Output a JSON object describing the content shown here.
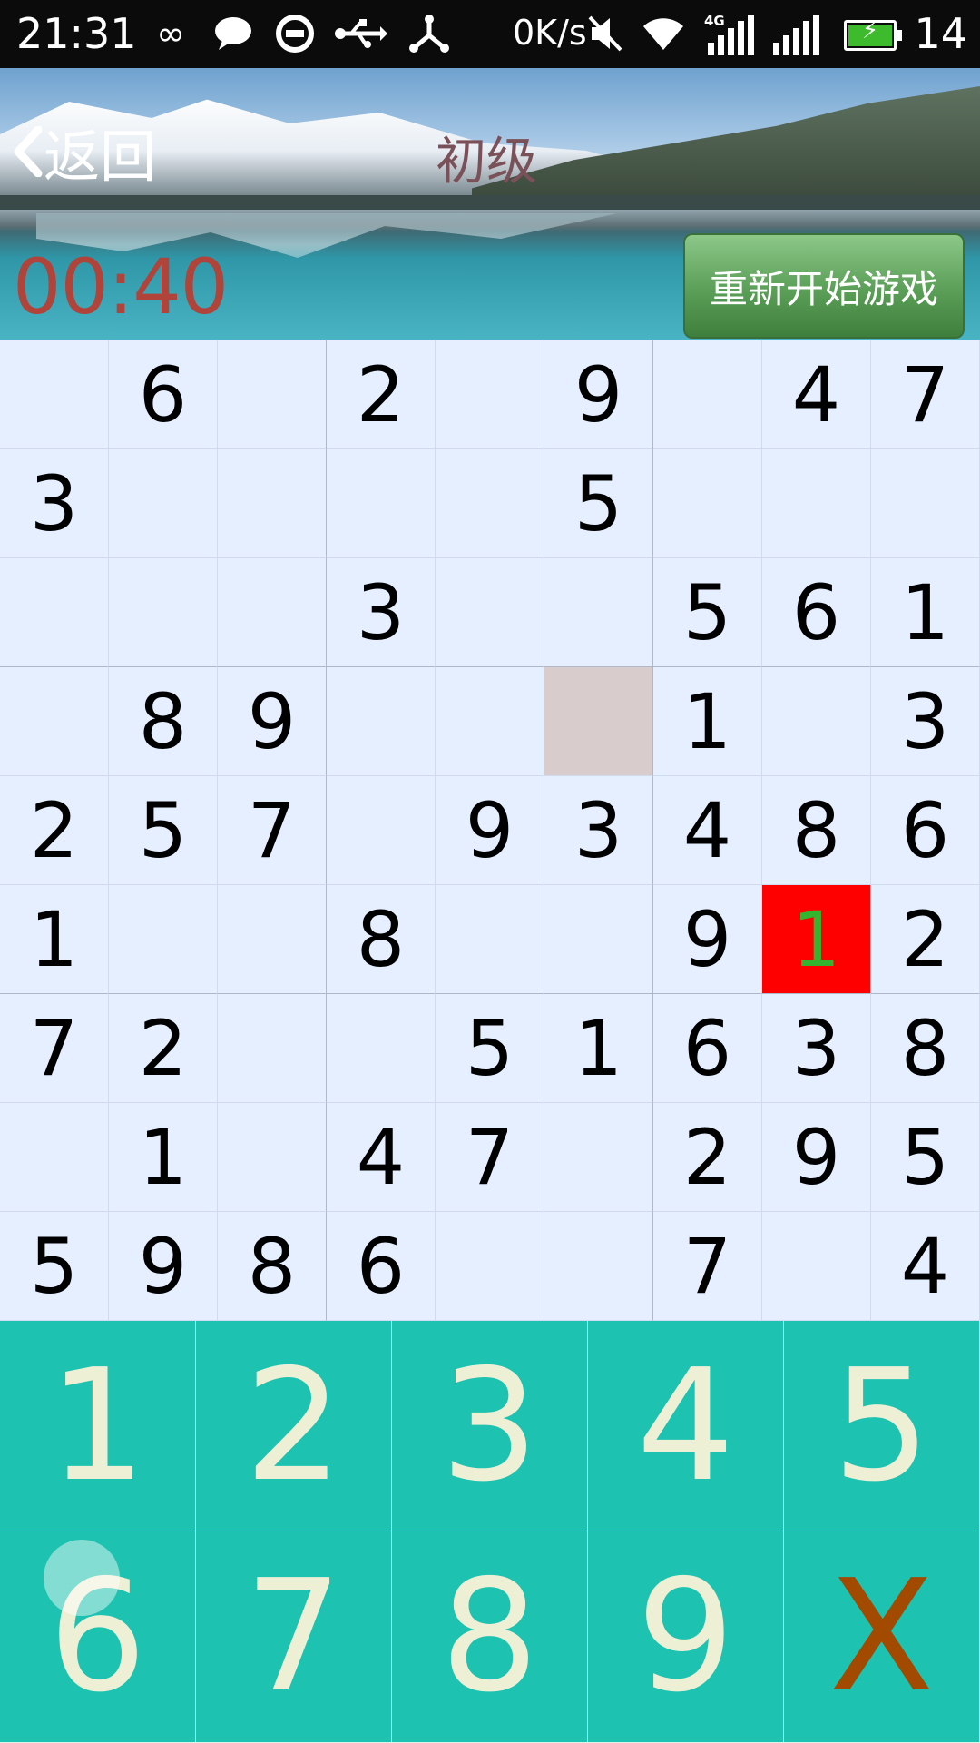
{
  "status_bar": {
    "time": "21:31",
    "speed": "0K/s",
    "signal_label": "4G",
    "battery_level": "14",
    "icons": [
      "infinity-icon",
      "chat-icon",
      "sync-icon",
      "usb-icon",
      "share-icon",
      "mute-icon",
      "wifi-icon",
      "signal-4g-icon",
      "signal-icon",
      "battery-icon"
    ]
  },
  "header": {
    "back_label": "返回",
    "level": "初级",
    "timer": "00:40",
    "restart_label": "重新开始游戏"
  },
  "board": {
    "rows": [
      [
        "",
        "6",
        "",
        "2",
        "",
        "9",
        "",
        "4",
        "7"
      ],
      [
        "3",
        "",
        "",
        "",
        "",
        "5",
        "",
        "",
        ""
      ],
      [
        "",
        "",
        "",
        "3",
        "",
        "",
        "5",
        "6",
        "1"
      ],
      [
        "",
        "8",
        "9",
        "",
        "",
        "",
        "1",
        "",
        "3"
      ],
      [
        "2",
        "5",
        "7",
        "",
        "9",
        "3",
        "4",
        "8",
        "6"
      ],
      [
        "1",
        "",
        "",
        "8",
        "",
        "",
        "9",
        "1",
        "2"
      ],
      [
        "7",
        "2",
        "",
        "",
        "5",
        "1",
        "6",
        "3",
        "8"
      ],
      [
        "",
        "1",
        "",
        "4",
        "7",
        "",
        "2",
        "9",
        "5"
      ],
      [
        "5",
        "9",
        "8",
        "6",
        "",
        "",
        "7",
        "",
        "4"
      ]
    ],
    "selected_cell": [
      3,
      5
    ],
    "error_cell": [
      5,
      7
    ]
  },
  "keypad": {
    "keys": [
      "1",
      "2",
      "3",
      "4",
      "5",
      "6",
      "7",
      "8",
      "9",
      "X"
    ]
  },
  "colors": {
    "board_bg": "#e6efff",
    "selected": "#d8cccc",
    "error_bg": "#ff0000",
    "error_text": "#35b52f",
    "keypad_bg": "#1ec2b0",
    "timer": "#b0433a"
  }
}
